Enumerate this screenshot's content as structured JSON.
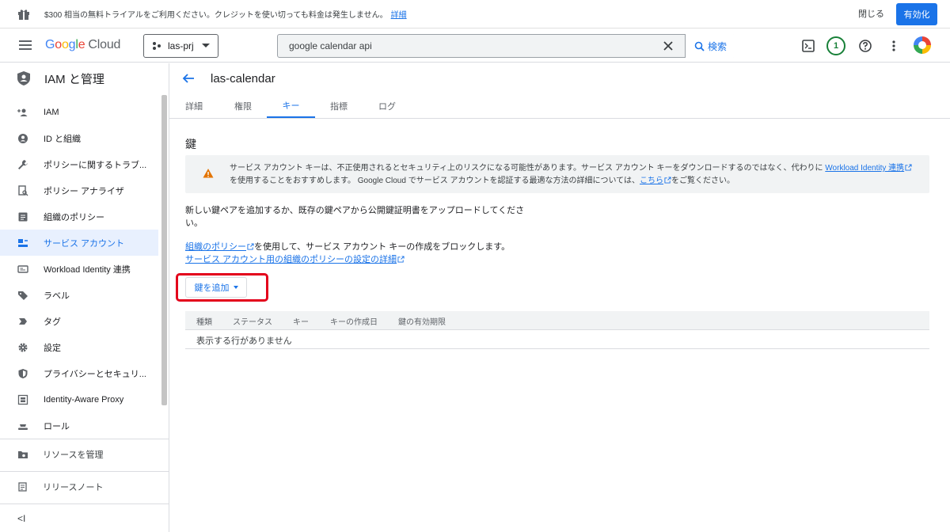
{
  "trial": {
    "message": "$300 相当の無料トライアルをご利用ください。クレジットを使い切っても料金は発生しません。",
    "details_link": "詳細",
    "close_label": "閉じる",
    "activate_label": "有効化"
  },
  "header": {
    "logo_g": "G",
    "logo_o1": "o",
    "logo_o2": "o",
    "logo_g2": "g",
    "logo_l": "l",
    "logo_e": "e",
    "logo_cloud": "Cloud",
    "project": "las-prj",
    "search_value": "google calendar api",
    "search_button": "検索",
    "notification_count": "1"
  },
  "sidebar": {
    "title": "IAM と管理",
    "items": [
      {
        "label": "IAM",
        "icon": "person-add-icon"
      },
      {
        "label": "ID と組織",
        "icon": "account-circle-icon"
      },
      {
        "label": "ポリシーに関するトラブ...",
        "icon": "wrench-icon"
      },
      {
        "label": "ポリシー アナライザ",
        "icon": "document-search-icon"
      },
      {
        "label": "組織のポリシー",
        "icon": "list-doc-icon"
      },
      {
        "label": "サービス アカウント",
        "icon": "service-account-icon"
      },
      {
        "label": "Workload Identity 連携",
        "icon": "id-card-icon"
      },
      {
        "label": "ラベル",
        "icon": "label-icon"
      },
      {
        "label": "タグ",
        "icon": "tag-icon"
      },
      {
        "label": "設定",
        "icon": "gear-icon"
      },
      {
        "label": "プライバシーとセキュリ...",
        "icon": "shield-icon"
      },
      {
        "label": "Identity-Aware Proxy",
        "icon": "proxy-icon"
      },
      {
        "label": "ロール",
        "icon": "role-icon"
      }
    ],
    "manage_resources": "リソースを管理",
    "release_notes": "リリースノート",
    "collapse": "<I"
  },
  "main": {
    "title": "las-calendar",
    "tabs": [
      "詳細",
      "権限",
      "キー",
      "指標",
      "ログ"
    ],
    "active_tab": "キー",
    "section_title": "鍵",
    "warning": {
      "text1": "サービス アカウント キーは、不正使用されるとセキュリティ上のリスクになる可能性があります。サービス アカウント キーをダウンロードするのではなく、代わりに ",
      "link1": "Workload Identity 連携",
      "text2": "を使用することをおすすめします。 Google Cloud でサービス アカウントを認証する最適な方法の詳細については、",
      "link2": "こちら",
      "text3": "をご覧ください。"
    },
    "description": "新しい鍵ペアを追加するか、既存の鍵ペアから公開鍵証明書をアップロードしてください。",
    "policy_link": "組織のポリシー",
    "policy_text": "を使用して、サービス アカウント キーの作成をブロックします。",
    "policy_details_link": "サービス アカウント用の組織のポリシーの設定の詳細",
    "add_key_label": "鍵を追加",
    "table_headers": [
      "種類",
      "ステータス",
      "キー",
      "キーの作成日",
      "鍵の有効期限"
    ],
    "empty_message": "表示する行がありません"
  },
  "colors": {
    "accent": "#1a73e8",
    "highlight": "#e3001b",
    "warning": "#e37400"
  }
}
